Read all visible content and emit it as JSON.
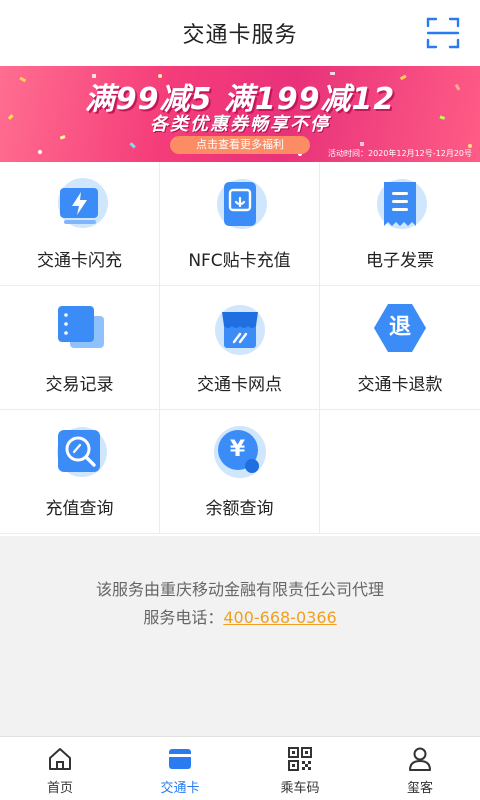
{
  "header": {
    "title": "交通卡服务",
    "scan_icon": "scan-icon"
  },
  "banner": {
    "headline": "满99减5 满199减12",
    "subline": "各类优惠券畅享不停",
    "cta": "点击查看更多福利",
    "period": "活动时间：2020年12月12号-12月20号"
  },
  "services": [
    {
      "label": "交通卡闪充",
      "icon": "flash-charge-icon"
    },
    {
      "label": "NFC贴卡充值",
      "icon": "nfc-card-icon"
    },
    {
      "label": "电子发票",
      "icon": "invoice-icon"
    },
    {
      "label": "交易记录",
      "icon": "records-icon"
    },
    {
      "label": "交通卡网点",
      "icon": "store-icon"
    },
    {
      "label": "交通卡退款",
      "icon": "refund-icon",
      "glyph": "退"
    },
    {
      "label": "充值查询",
      "icon": "recharge-query-icon"
    },
    {
      "label": "余额查询",
      "icon": "balance-query-icon",
      "glyph": "¥"
    }
  ],
  "info": {
    "line1": "该服务由重庆移动金融有限责任公司代理",
    "phone_label": "服务电话：",
    "phone": "400-668-0366"
  },
  "tabs": [
    {
      "label": "首页",
      "icon": "home-icon",
      "active": false
    },
    {
      "label": "交通卡",
      "icon": "card-icon",
      "active": true
    },
    {
      "label": "乘车码",
      "icon": "qr-code-icon",
      "active": false
    },
    {
      "label": "玺客",
      "icon": "user-icon",
      "active": false
    }
  ],
  "colors": {
    "accent": "#2a7bf0",
    "icon_light": "#cfe6fd",
    "icon_blue": "#3b8cf7",
    "phone": "#f0a020",
    "banner": "#f0447e"
  }
}
